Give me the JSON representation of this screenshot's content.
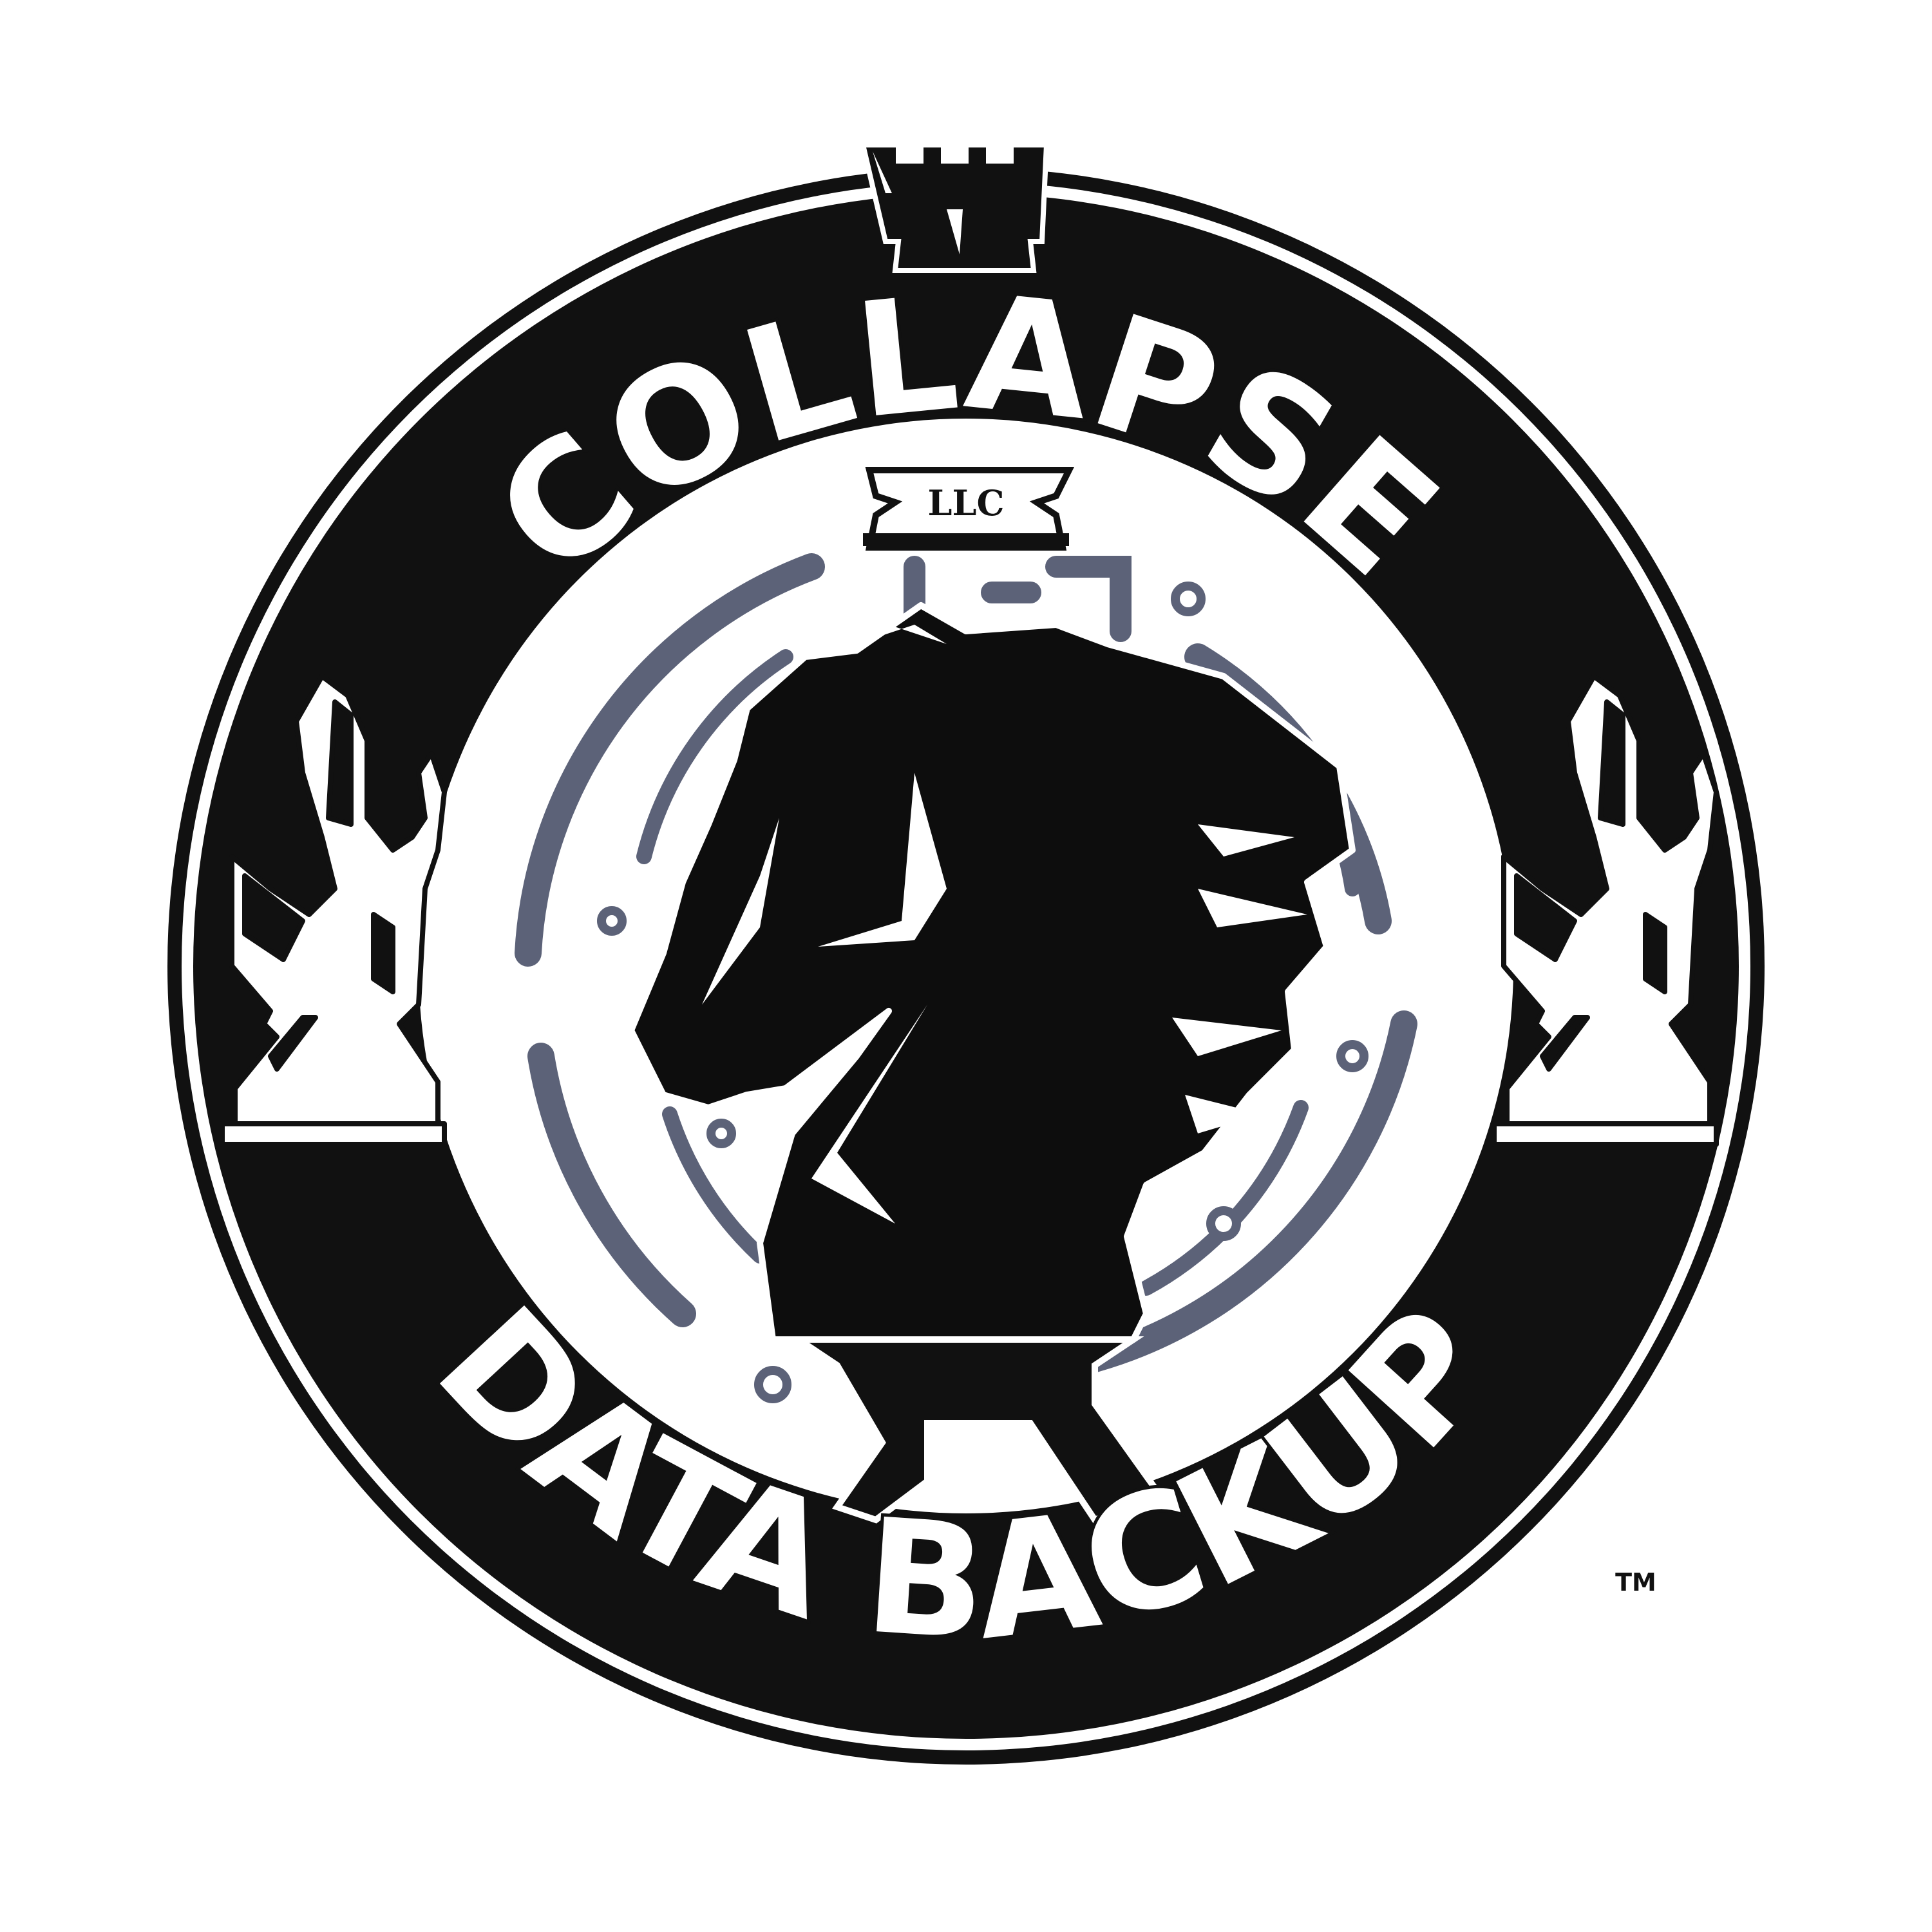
{
  "logo": {
    "top_arc_text": "COLLAPSE",
    "bottom_arc_text": "DATA BACKUP",
    "llc_label": "LLC",
    "trademark": "TM",
    "central_emblem": "knight-chess-piece",
    "side_emblems": [
      "chess-king-queen-group-left",
      "chess-king-queen-group-right"
    ],
    "colors": {
      "ring": "#111111",
      "background": "#ffffff",
      "circuit": "#5c6278",
      "knight": "#0d0d0d",
      "lettering": "#ffffff"
    }
  }
}
